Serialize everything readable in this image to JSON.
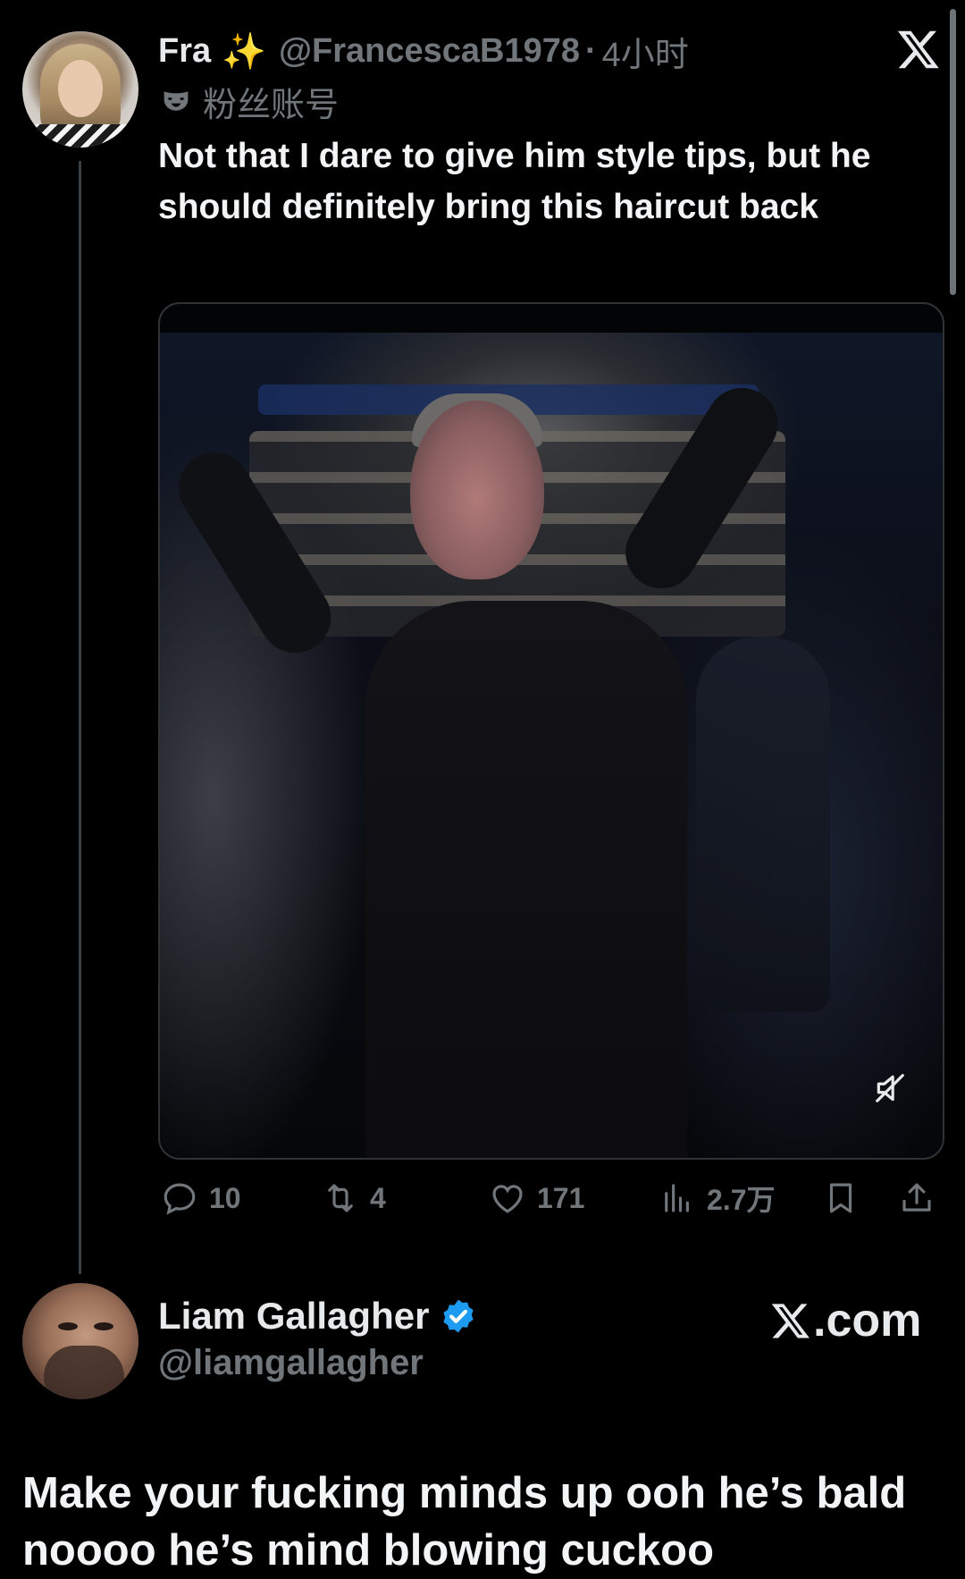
{
  "tweet1": {
    "display_name": "Fra",
    "sparkle_icon": "✨",
    "handle": "@FrancescaB1978",
    "separator": "·",
    "time": "4小时",
    "badge_label": "粉丝账号",
    "text": "Not that I dare to give him style tips, but he should definitely bring this haircut back",
    "actions": {
      "replies": "10",
      "reposts": "4",
      "likes": "171",
      "views": "2.7万"
    }
  },
  "tweet2": {
    "display_name": "Liam Gallagher",
    "handle": "@liamgallagher",
    "source": ".com",
    "text": "Make your fucking minds up ooh he’s bald noooo he’s mind blowing cuckoo"
  },
  "icons": {
    "platform": "x-logo-icon",
    "badge": "fan-mask-icon",
    "verified": "verified-badge-icon",
    "mute": "mute-icon",
    "reply": "reply-icon",
    "repost": "repost-icon",
    "like": "heart-icon",
    "views": "views-icon",
    "bookmark": "bookmark-icon",
    "share": "share-icon"
  },
  "colors": {
    "background": "#000000",
    "text_primary": "#e7e9ea",
    "text_secondary": "#71767b",
    "verified": "#1d9bf0",
    "sparkle": "#f5d25a"
  }
}
